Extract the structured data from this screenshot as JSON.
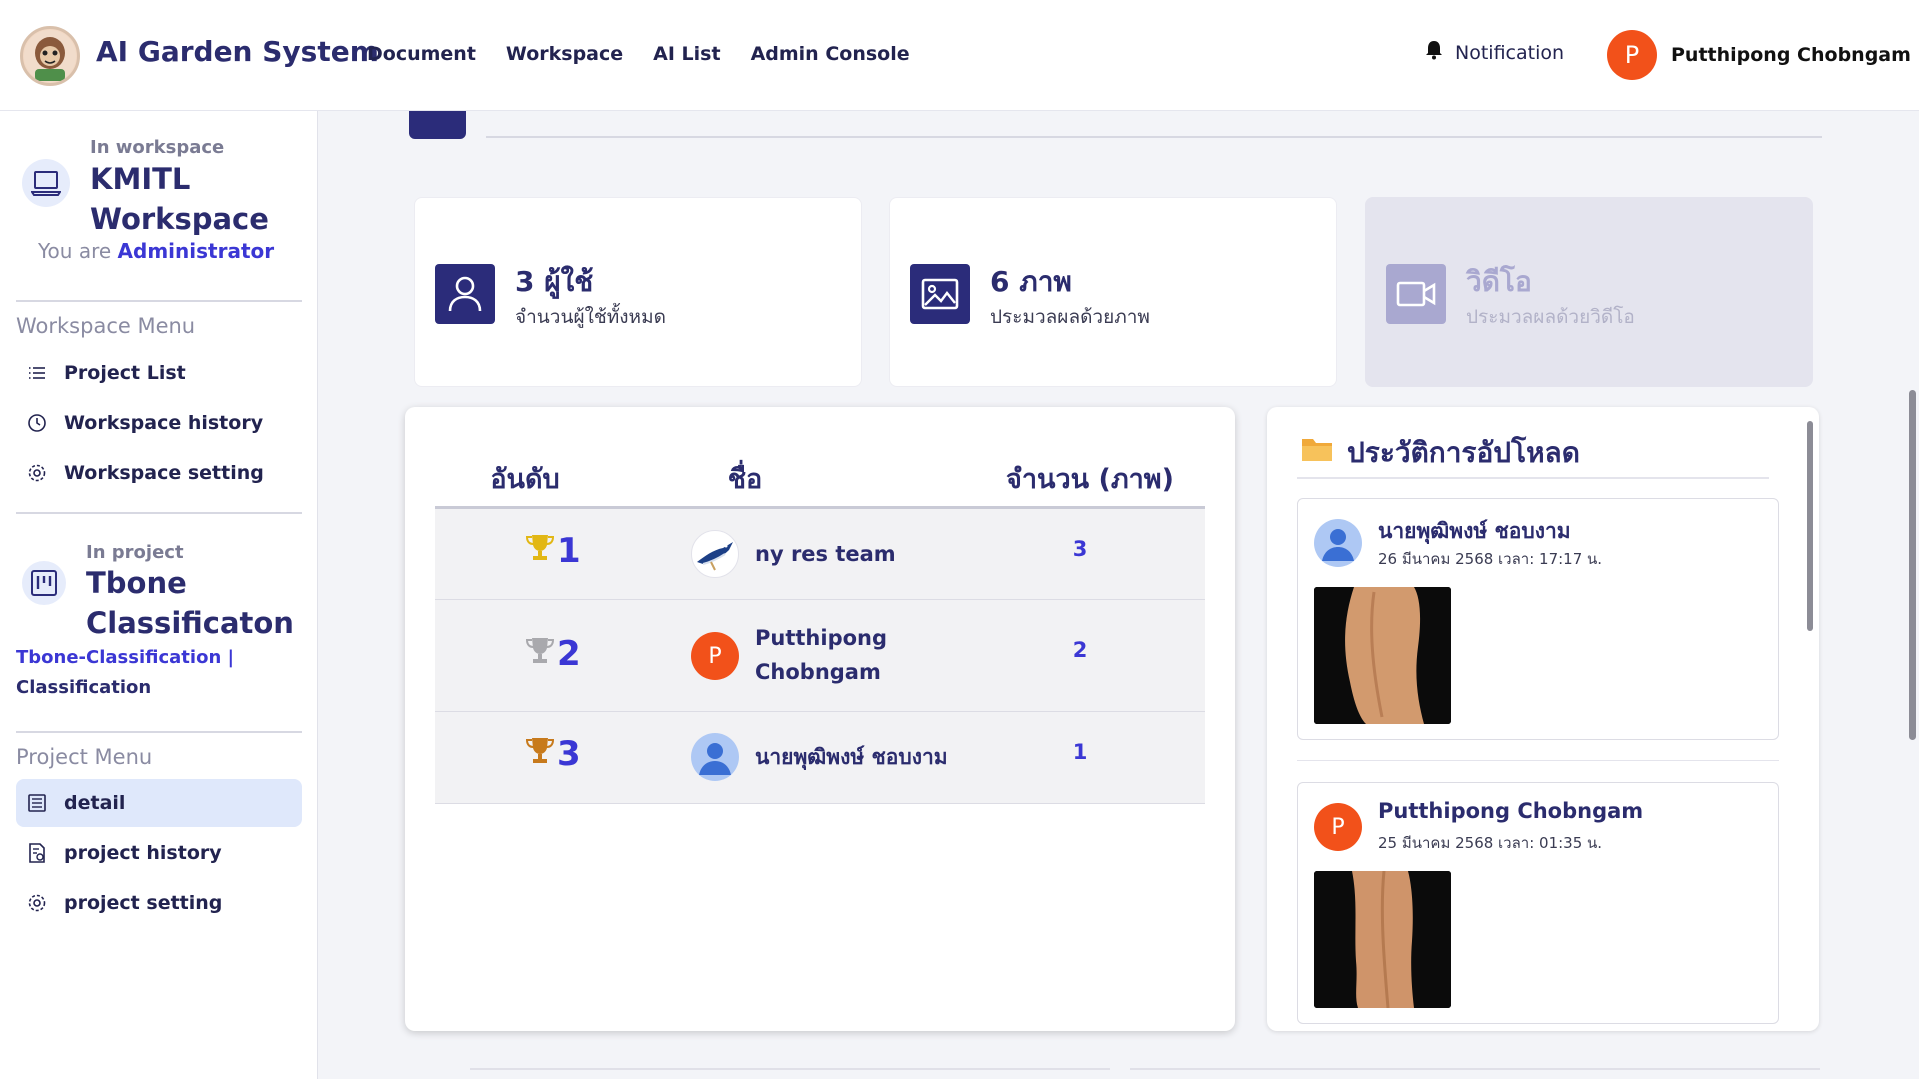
{
  "app": {
    "brand": "AI Garden System",
    "nav": [
      "Document",
      "Workspace",
      "AI List",
      "Admin Console"
    ],
    "notification_label": "Notification",
    "user_initial": "P",
    "user_name": "Putthipong Chobngam"
  },
  "sidebar": {
    "workspace_sub": "In workspace",
    "workspace_name": "KMITL Workspace",
    "role_prefix": "You are",
    "role": "Administrator",
    "workspace_menu_title": "Workspace Menu",
    "workspace_menu": [
      "Project List",
      "Workspace history",
      "Workspace setting"
    ],
    "project_sub": "In project",
    "project_name": "Tbone Classificaton",
    "project_link": "Tbone-Classification |",
    "project_type": "Classification",
    "project_menu_title": "Project Menu",
    "project_menu": [
      "detail",
      "project history",
      "project setting"
    ]
  },
  "stats": [
    {
      "value": "3 ผู้ใช้",
      "label": "จำนวนผู้ใช้ทั้งหมด",
      "icon": "user-icon",
      "disabled": false
    },
    {
      "value": "6 ภาพ",
      "label": "ประมวลผลด้วยภาพ",
      "icon": "image-icon",
      "disabled": false
    },
    {
      "value": "วิดีโอ",
      "label": "ประมวลผลด้วยวิดีโอ",
      "icon": "video-icon",
      "disabled": true
    }
  ],
  "ranking": {
    "headers": [
      "อันดับ",
      "ชื่อ",
      "จำนวน (ภาพ)"
    ],
    "rows": [
      {
        "rank": "1",
        "trophy": "gold",
        "name": "ny res team",
        "count": "3"
      },
      {
        "rank": "2",
        "trophy": "silver",
        "name": "Putthipong Chobngam",
        "count": "2"
      },
      {
        "rank": "3",
        "trophy": "bronze",
        "name": "นายพุฒิพงษ์ ชอบงาม",
        "count": "1"
      }
    ]
  },
  "uploads": {
    "title": "ประวัติการอัปโหลด",
    "items": [
      {
        "name": "นายพุฒิพงษ์ ชอบงาม",
        "date": "26 มีนาคม 2568 เวลา: 17:17 น."
      },
      {
        "name": "Putthipong Chobngam",
        "date": "25 มีนาคม 2568 เวลา: 01:35 น.",
        "initial": "P"
      }
    ]
  },
  "colors": {
    "primary": "#2b2c7a",
    "accent": "#3b37d4",
    "avatar_orange": "#f2511a",
    "gold": "#e2b714",
    "silver": "#a9a9ad",
    "bronze": "#c77a1c"
  }
}
